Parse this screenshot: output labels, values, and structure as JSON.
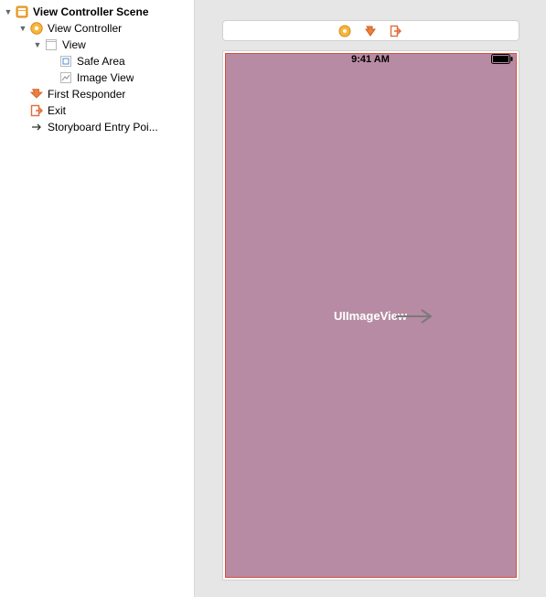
{
  "outline": {
    "scene": "View Controller Scene",
    "viewController": "View Controller",
    "view": "View",
    "safeArea": "Safe Area",
    "imageView": "Image View",
    "firstResponder": "First Responder",
    "exit": "Exit",
    "entryPoint": "Storyboard Entry Poi..."
  },
  "canvas": {
    "statusTime": "9:41 AM",
    "placeholderLabel": "UIImageView"
  },
  "icons": {
    "scene": "scene-icon",
    "viewController": "view-controller-icon",
    "view": "view-icon",
    "safeArea": "safe-area-icon",
    "imageView": "image-view-icon",
    "firstResponder": "first-responder-icon",
    "exit": "exit-icon",
    "entryArrow": "arrow-right-icon"
  }
}
